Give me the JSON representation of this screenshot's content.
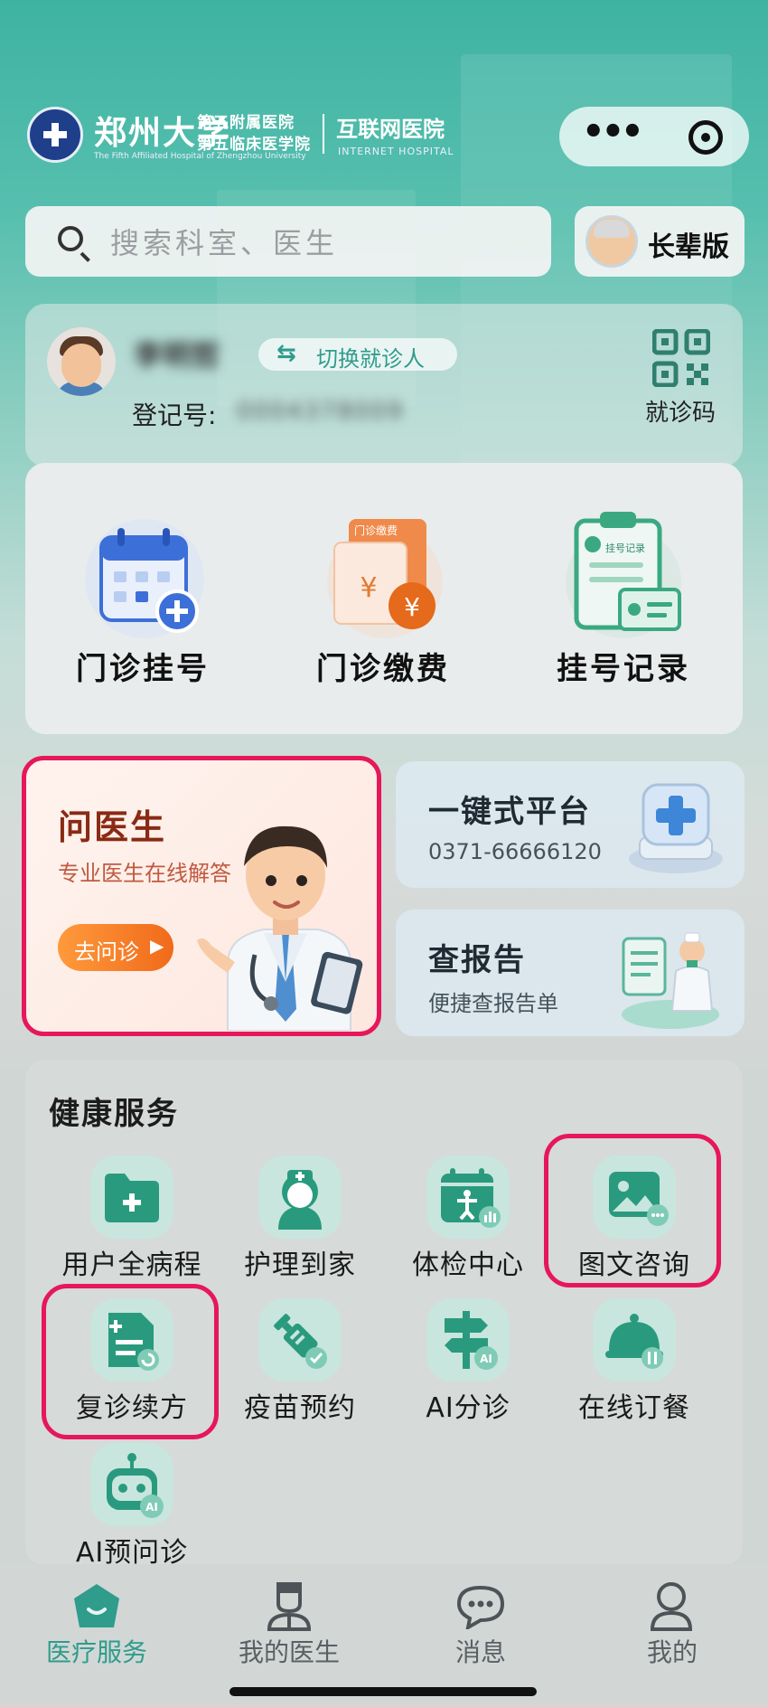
{
  "header": {
    "university": "郑州大学",
    "hospital_line1": "第五附属医院",
    "hospital_line2": "第五临床医学院",
    "hospital_en": "The Fifth Affiliated Hospital of Zhengzhou University",
    "internet_cn": "互联网医院",
    "internet_en": "INTERNET HOSPITAL",
    "capsule_more": "•••"
  },
  "search": {
    "placeholder": "搜索科室、医生",
    "elder_mode_label": "长辈版"
  },
  "patient": {
    "name": "李明哲",
    "switch_label": "切换就诊人",
    "switch_icon": "⇆",
    "reg_label": "登记号:",
    "reg_value": "0004378009",
    "qr_label": "就诊码"
  },
  "quick_actions": [
    {
      "label": "门诊挂号",
      "icon": "calendar-plus-icon"
    },
    {
      "label": "门诊缴费",
      "icon": "payment-receipt-icon"
    },
    {
      "label": "挂号记录",
      "icon": "clipboard-record-icon"
    }
  ],
  "quick_icon_texts": {
    "payment_tag": "门诊缴费",
    "record_tag": "挂号记录"
  },
  "ask_doctor": {
    "title": "问医生",
    "subtitle": "专业医生在线解答",
    "button": "去问诊"
  },
  "platform": {
    "title": "一键式平台",
    "phone": "0371-66666120"
  },
  "report": {
    "title": "查报告",
    "subtitle": "便捷查报告单"
  },
  "health_services": {
    "title": "健康服务",
    "items": [
      {
        "label": "用户全病程",
        "icon": "folder-plus-icon",
        "highlighted": false
      },
      {
        "label": "护理到家",
        "icon": "nurse-icon",
        "highlighted": false
      },
      {
        "label": "体检中心",
        "icon": "checkup-calendar-icon",
        "highlighted": false
      },
      {
        "label": "图文咨询",
        "icon": "image-chat-icon",
        "highlighted": true
      },
      {
        "label": "复诊续方",
        "icon": "prescription-renew-icon",
        "highlighted": true
      },
      {
        "label": "疫苗预约",
        "icon": "syringe-icon",
        "highlighted": false
      },
      {
        "label": "AI分诊",
        "icon": "signpost-ai-icon",
        "highlighted": false
      },
      {
        "label": "在线订餐",
        "icon": "dish-cover-icon",
        "highlighted": false
      },
      {
        "label": "AI预问诊",
        "icon": "robot-ai-icon",
        "highlighted": false
      }
    ]
  },
  "tabbar": [
    {
      "label": "医疗服务",
      "icon": "medical-home-icon",
      "active": true
    },
    {
      "label": "我的医生",
      "icon": "doctor-icon",
      "active": false
    },
    {
      "label": "消息",
      "icon": "message-icon",
      "active": false
    },
    {
      "label": "我的",
      "icon": "profile-icon",
      "active": false
    }
  ],
  "colors": {
    "brand": "#2f9c8c",
    "highlight": "#e6175a",
    "ask_button": "#f47a24"
  }
}
